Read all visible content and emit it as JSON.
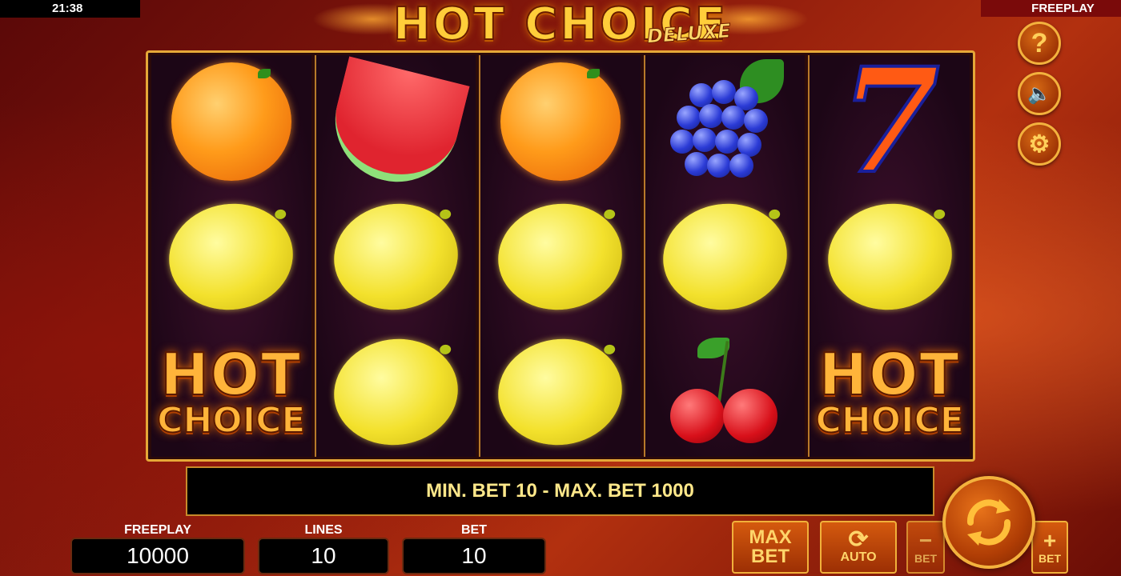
{
  "status": {
    "clock": "21:38",
    "mode": "FREEPLAY"
  },
  "logo": {
    "title": "HOT CHOICE",
    "subtitle": "DELUXE"
  },
  "side_buttons": [
    {
      "icon": "help-icon",
      "glyph": "?"
    },
    {
      "icon": "sound-muted-icon",
      "glyph": "🔈"
    },
    {
      "icon": "gear-icon",
      "glyph": "⚙"
    }
  ],
  "reels": [
    [
      "orange",
      "lemon",
      "hot-choice"
    ],
    [
      "watermelon",
      "lemon",
      "lemon"
    ],
    [
      "orange",
      "lemon",
      "lemon"
    ],
    [
      "grapes",
      "lemon",
      "cherries"
    ],
    [
      "seven",
      "lemon",
      "hot-choice"
    ]
  ],
  "symbol_text": {
    "hot": "HOT",
    "choice": "CHOICE",
    "seven": "7"
  },
  "info_bar": {
    "message": "MIN. BET 10 - MAX. BET 1000"
  },
  "stats": {
    "freeplay_label": "FREEPLAY",
    "freeplay_value": "10000",
    "lines_label": "LINES",
    "lines_value": "10",
    "bet_label": "BET",
    "bet_value": "10"
  },
  "controls": {
    "max_bet_line1": "MAX",
    "max_bet_line2": "BET",
    "auto_label": "AUTO",
    "minus_glyph": "−",
    "minus_label": "BET",
    "plus_glyph": "+",
    "plus_label": "BET"
  },
  "colors": {
    "accent": "#f3b23d",
    "info_text": "#ffe88a",
    "background": "#8c1a0c"
  }
}
